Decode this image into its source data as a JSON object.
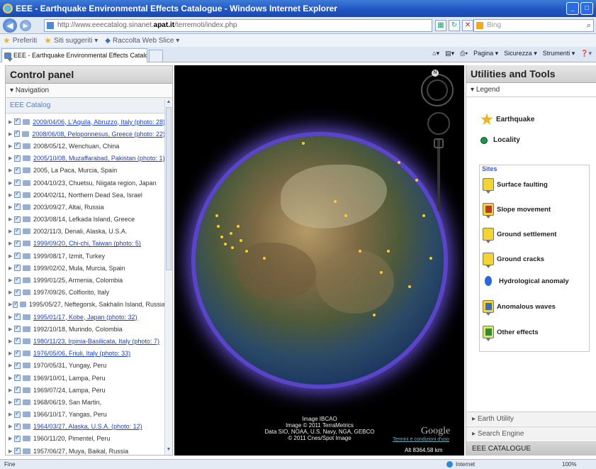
{
  "window": {
    "title": "EEE - Earthquake Environmental Effects Catalogue - Windows Internet Explorer"
  },
  "address": {
    "url_prefix": "http://www.eeecatalog.sinanet.",
    "url_domain": "apat.it",
    "url_suffix": "/terremoti/index.php",
    "search_placeholder": "Bing"
  },
  "favorites": {
    "label": "Preferiti",
    "items": [
      "Siti suggeriti ▾",
      "Raccolta Web Slice ▾"
    ]
  },
  "tab": {
    "label": "EEE - Earthquake Environmental Effects Catalogue",
    "commands": [
      "Pagina ▾",
      "Sicurezza ▾",
      "Strumenti ▾"
    ]
  },
  "left": {
    "title": "Control panel",
    "nav_label": "Navigation",
    "catalog_label": "EEE Catalog",
    "events": [
      {
        "text": "2009/04/06, L'Aquila, Abruzzo, Italy (photo: 28)",
        "link": true
      },
      {
        "text": "2008/06/08, Peloponnesus, Greece (photo: 22)",
        "link": true
      },
      {
        "text": "2008/05/12, Wenchuan, China",
        "link": false
      },
      {
        "text": "2005/10/08, Muzaffarabad, Pakistan (photo: 1)",
        "link": true
      },
      {
        "text": "2005, La Paca, Murcia, Spain",
        "link": false
      },
      {
        "text": "2004/10/23, Chuetsu, Niigata region, Japan",
        "link": false
      },
      {
        "text": "2004/02/11, Northern Dead Sea, Israel",
        "link": false
      },
      {
        "text": "2003/09/27, Altai, Russia",
        "link": false
      },
      {
        "text": "2003/08/14, Lefkada Island, Greece",
        "link": false
      },
      {
        "text": "2002/11/3, Denali, Alaska, U.S.A.",
        "link": false
      },
      {
        "text": "1999/09/20, Chi-chi, Taiwan (photo: 5)",
        "link": true
      },
      {
        "text": "1999/08/17, Izmit, Turkey",
        "link": false
      },
      {
        "text": "1999/02/02, Mula, Murcia, Spain",
        "link": false
      },
      {
        "text": "1999/01/25, Armenia, Colombia",
        "link": false
      },
      {
        "text": "1997/09/26, Colfiorito, Italy",
        "link": false
      },
      {
        "text": "1995/05/27, Neftegorsk, Sakhalin Island, Russia",
        "link": false
      },
      {
        "text": "1995/01/17, Kobe, Japan (photo: 32)",
        "link": true
      },
      {
        "text": "1992/10/18, Murindo, Colombia",
        "link": false
      },
      {
        "text": "1980/11/23, Irpinia-Basilicata, Italy (photo: 7)",
        "link": true
      },
      {
        "text": "1976/05/06, Friuli, Italy (photo: 33)",
        "link": true
      },
      {
        "text": "1970/05/31, Yungay, Peru",
        "link": false
      },
      {
        "text": "1969/10/01, Lampa, Peru",
        "link": false
      },
      {
        "text": "1969/07/24, Lampa, Peru",
        "link": false
      },
      {
        "text": "1968/06/19, San Martin,",
        "link": false
      },
      {
        "text": "1966/10/17, Yangas, Peru",
        "link": false
      },
      {
        "text": "1964/03/27, Alaska, U.S.A. (photo: 12)",
        "link": true
      },
      {
        "text": "1960/11/20, Pimentel, Peru",
        "link": false
      },
      {
        "text": "1957/06/27, Muya, Baikal, Russia",
        "link": false
      }
    ]
  },
  "globe": {
    "attribution": [
      "Image IBCAO",
      "Image © 2011 TerraMetrics",
      "Data SIO, NOAA, U.S. Navy, NGA, GEBCO",
      "© 2011 Cnes/Spot Image"
    ],
    "brand": "Google",
    "terms": "Termini e condizioni d'uso",
    "altitude": "Alt 8364.58 km",
    "compass_n": "N"
  },
  "right": {
    "title": "Utilities and Tools",
    "legend_label": "Legend",
    "earthquake_label": "Earthquake",
    "locality_label": "Locality",
    "sites_title": "Sites",
    "sites": [
      "Surface faulting",
      "Slope movement",
      "Ground settlement",
      "Ground cracks",
      "Hydrological anomaly",
      "Anomalous waves",
      "Other effects"
    ],
    "earth_utility": "Earth Utility",
    "search_engine": "Search Engine",
    "catalogue": "EEE CATALOGUE"
  },
  "status": {
    "left": "Fine",
    "zone": "Internet",
    "zoom": "100%"
  },
  "colors": {
    "link": "#1b3fc9",
    "titlebar": "#1f54c0",
    "marker": "#ffc92e"
  }
}
